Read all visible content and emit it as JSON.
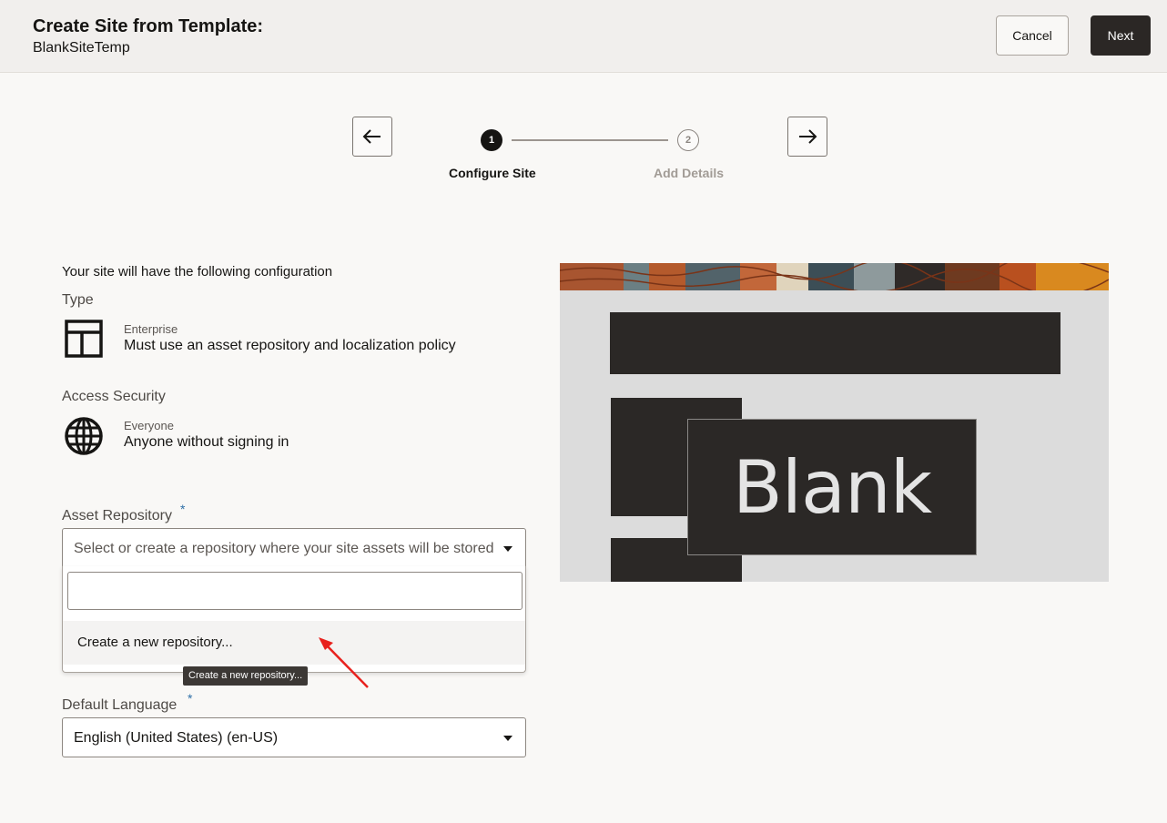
{
  "header": {
    "title": "Create Site from Template:",
    "subtitle": "BlankSiteTemp",
    "cancel_label": "Cancel",
    "next_label": "Next"
  },
  "stepper": {
    "steps": [
      {
        "number": "1",
        "label": "Configure Site",
        "active": true
      },
      {
        "number": "2",
        "label": "Add Details",
        "active": false
      }
    ]
  },
  "config": {
    "intro": "Your site will have the following configuration",
    "type": {
      "label": "Type",
      "icon": "layout-icon",
      "name": "Enterprise",
      "description": "Must use an asset repository and localization policy"
    },
    "access": {
      "label": "Access Security",
      "icon": "globe-icon",
      "name": "Everyone",
      "description": "Anyone without signing in"
    }
  },
  "asset_repository": {
    "label": "Asset Repository",
    "required_mark": "*",
    "placeholder": "Select or create a repository where your site assets will be stored",
    "search_value": "",
    "options": [
      "Create a new repository..."
    ],
    "tooltip": "Create a new repository..."
  },
  "default_language": {
    "label": "Default Language",
    "required_mark": "*",
    "value": "English (United States) (en-US)"
  },
  "preview": {
    "text": "Blank"
  },
  "colors": {
    "primary_button": "#2b2725",
    "header_bg": "#f1efed",
    "page_bg": "#f9f8f6",
    "annotation_arrow": "#e8211d",
    "required_mark": "#2e6fa7"
  }
}
